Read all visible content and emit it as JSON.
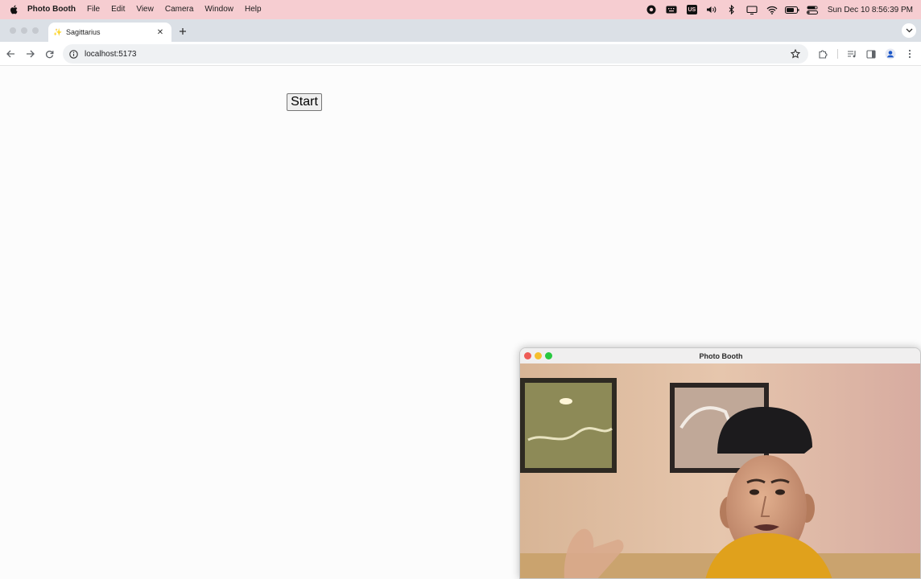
{
  "menubar": {
    "items": [
      "Photo Booth",
      "File",
      "Edit",
      "View",
      "Camera",
      "Window",
      "Help"
    ],
    "status_icons": [
      "record-icon",
      "keyboard-icon",
      "input-source-icon",
      "volume-icon",
      "bluetooth-icon",
      "display-icon",
      "wifi-icon",
      "battery-icon",
      "control-center-icon"
    ],
    "input_source": "US",
    "clock": "Sun Dec 10  8:56:39 PM"
  },
  "browser": {
    "tab_title": "Sagittarius",
    "url": "localhost:5173"
  },
  "page": {
    "start_label": "Start"
  },
  "photobooth": {
    "title": "Photo Booth"
  },
  "colors": {
    "menubar_bg": "#f6cdd1",
    "tabstrip_bg": "#dbe0e6",
    "close_red": "#ee5b56",
    "minimize_yellow": "#f5bf2e",
    "zoom_green": "#28c840"
  }
}
